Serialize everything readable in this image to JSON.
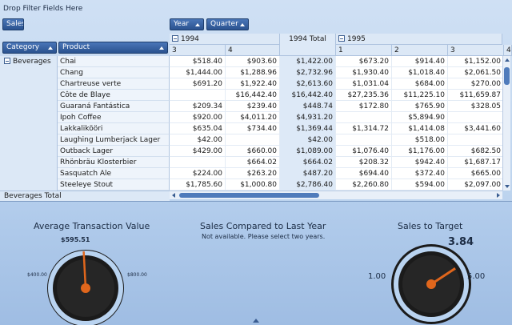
{
  "filter_area": {
    "label": "Drop Filter Fields Here"
  },
  "fields": {
    "data_field": "Sales",
    "column_fields": [
      "Year",
      "Quarter"
    ],
    "row_fields": [
      "Category",
      "Product"
    ]
  },
  "columns": {
    "year_1994": "1994",
    "year_1994_total": "1994 Total",
    "year_1995": "1995",
    "quarters": [
      "3",
      "4",
      "",
      "1",
      "2",
      "3",
      "4"
    ]
  },
  "category": {
    "name": "Beverages",
    "total_label": "Beverages Total"
  },
  "rows": [
    {
      "product": "Chai",
      "values": [
        "$518.40",
        "$903.60",
        "$1,422.00",
        "$673.20",
        "$914.40",
        "$1,152.00"
      ]
    },
    {
      "product": "Chang",
      "values": [
        "$1,444.00",
        "$1,288.96",
        "$2,732.96",
        "$1,930.40",
        "$1,018.40",
        "$2,061.50"
      ]
    },
    {
      "product": "Chartreuse verte",
      "values": [
        "$691.20",
        "$1,922.40",
        "$2,613.60",
        "$1,031.04",
        "$684.00",
        "$270.00"
      ]
    },
    {
      "product": "Côte de Blaye",
      "values": [
        "",
        "$16,442.40",
        "$16,442.40",
        "$27,235.36",
        "$11,225.10",
        "$11,659.87"
      ]
    },
    {
      "product": "Guaraná Fantástica",
      "values": [
        "$209.34",
        "$239.40",
        "$448.74",
        "$172.80",
        "$765.90",
        "$328.05"
      ]
    },
    {
      "product": "Ipoh Coffee",
      "values": [
        "$920.00",
        "$4,011.20",
        "$4,931.20",
        "",
        "$5,894.90",
        ""
      ]
    },
    {
      "product": "Lakkalikööri",
      "values": [
        "$635.04",
        "$734.40",
        "$1,369.44",
        "$1,314.72",
        "$1,414.08",
        "$3,441.60"
      ]
    },
    {
      "product": "Laughing Lumberjack Lager",
      "values": [
        "$42.00",
        "",
        "$42.00",
        "",
        "$518.00",
        ""
      ]
    },
    {
      "product": "Outback Lager",
      "values": [
        "$429.00",
        "$660.00",
        "$1,089.00",
        "$1,076.40",
        "$1,176.00",
        "$682.50"
      ]
    },
    {
      "product": "Rhönbräu Klosterbier",
      "values": [
        "",
        "$664.02",
        "$664.02",
        "$208.32",
        "$942.40",
        "$1,687.17"
      ]
    },
    {
      "product": "Sasquatch Ale",
      "values": [
        "$224.00",
        "$263.20",
        "$487.20",
        "$694.40",
        "$372.40",
        "$665.00"
      ]
    },
    {
      "product": "Steeleye Stout",
      "values": [
        "$1,785.60",
        "$1,000.80",
        "$2,786.40",
        "$2,260.80",
        "$594.00",
        "$2,097.00"
      ]
    }
  ],
  "gauges": {
    "avg_transaction": {
      "title": "Average Transaction Value",
      "value_label": "$595.51",
      "min_label": "$400.00",
      "max_label": "$800.00",
      "value": 595.51,
      "min": 400,
      "max": 800
    },
    "sales_compared": {
      "title": "Sales Compared to Last Year",
      "message": "Not available. Please select two years."
    },
    "sales_target": {
      "title": "Sales to Target",
      "value_label": "3.84",
      "min_label": "1.00",
      "max_label": "5.00",
      "value": 3.84,
      "min": 1,
      "max": 5
    }
  },
  "colors": {
    "accent": "#2a528f",
    "needle": "#e0661c",
    "gauge_ring": "#b9d3f0"
  }
}
